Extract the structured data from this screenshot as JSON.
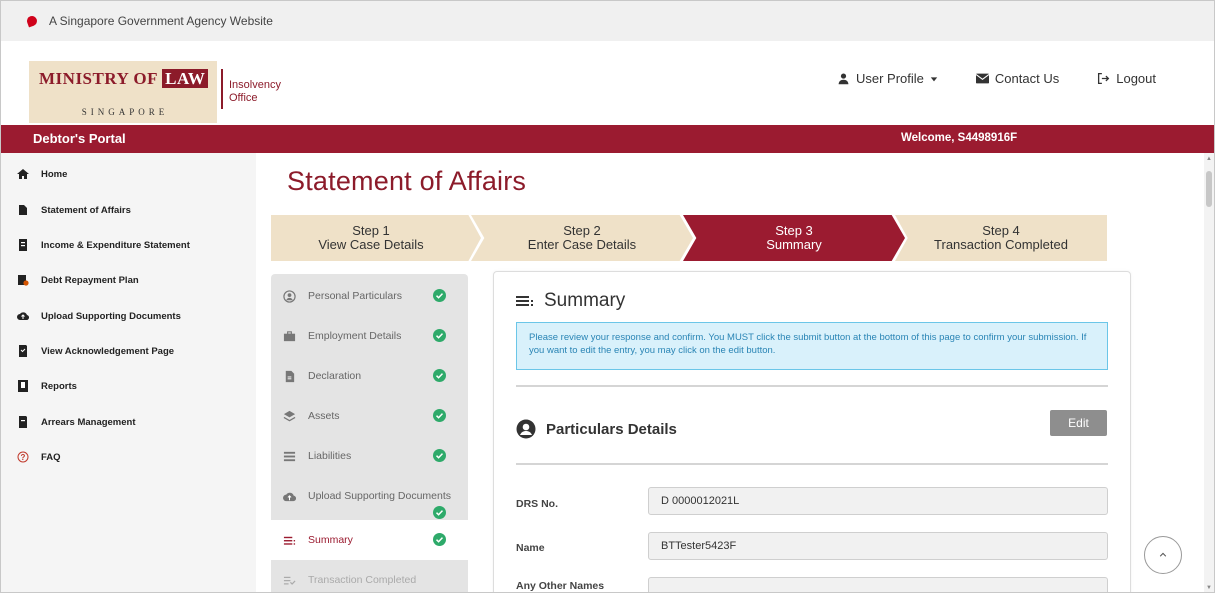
{
  "gov_banner": {
    "text": "A Singapore Government Agency Website"
  },
  "logo": {
    "main_prefix": "MINISTRY OF",
    "main_law": "LAW",
    "sub": "SINGAPORE",
    "office": "Insolvency Office"
  },
  "top_links": {
    "user_profile": "User Profile",
    "contact_us": "Contact Us",
    "logout": "Logout"
  },
  "portal": {
    "title": "Debtor's Portal",
    "welcome": "Welcome, S4498916F"
  },
  "sidebar": {
    "items": [
      {
        "label": "Home",
        "icon": "home-icon"
      },
      {
        "label": "Statement of Affairs",
        "icon": "document-icon"
      },
      {
        "label": "Income & Expenditure Statement",
        "icon": "ledger-icon"
      },
      {
        "label": "Debt Repayment Plan",
        "icon": "money-icon"
      },
      {
        "label": "Upload Supporting Documents",
        "icon": "cloud-upload-icon"
      },
      {
        "label": "View Acknowledgement Page",
        "icon": "page-icon"
      },
      {
        "label": "Reports",
        "icon": "report-icon"
      },
      {
        "label": "Arrears Management",
        "icon": "arrears-icon"
      },
      {
        "label": "FAQ",
        "icon": "question-icon"
      }
    ]
  },
  "page": {
    "title": "Statement of Affairs"
  },
  "steps": [
    {
      "line1": "Step 1",
      "line2": "View Case Details",
      "active": false
    },
    {
      "line1": "Step 2",
      "line2": "Enter Case Details",
      "active": false
    },
    {
      "line1": "Step 3",
      "line2": "Summary",
      "active": true
    },
    {
      "line1": "Step 4",
      "line2": "Transaction Completed",
      "active": false
    }
  ],
  "step_menu": {
    "items": [
      {
        "label": "Personal Particulars",
        "icon": "user-circle-icon",
        "complete": true
      },
      {
        "label": "Employment Details",
        "icon": "briefcase-icon",
        "complete": true
      },
      {
        "label": "Declaration",
        "icon": "file-icon",
        "complete": true
      },
      {
        "label": "Assets",
        "icon": "layers-icon",
        "complete": true
      },
      {
        "label": "Liabilities",
        "icon": "list-icon",
        "complete": true
      },
      {
        "label": "Upload Supporting Documents",
        "icon": "cloud-upload-icon",
        "complete": true
      },
      {
        "label": "Summary",
        "icon": "summary-icon",
        "complete": true,
        "active": true
      },
      {
        "label": "Transaction Completed",
        "icon": "done-list-icon",
        "complete": false,
        "disabled": true
      }
    ]
  },
  "summary": {
    "title": "Summary",
    "alert": "Please review your response and confirm. You MUST click the submit button at the bottom of this page to confirm your submission. If you want to edit the entry, you may click on the edit button.",
    "section_title": "Particulars Details",
    "edit_label": "Edit",
    "fields": [
      {
        "label": "DRS No.",
        "value": "D 0000012021L"
      },
      {
        "label": "Name",
        "value": "BTTester5423F"
      },
      {
        "label": "Any Other Names",
        "value": ""
      }
    ]
  },
  "colors": {
    "brand": "#9b1b30",
    "step_inactive": "#efe1c8",
    "success": "#2eaa6a",
    "alert_bg": "#d9f1fb",
    "alert_text": "#2a85b5"
  }
}
